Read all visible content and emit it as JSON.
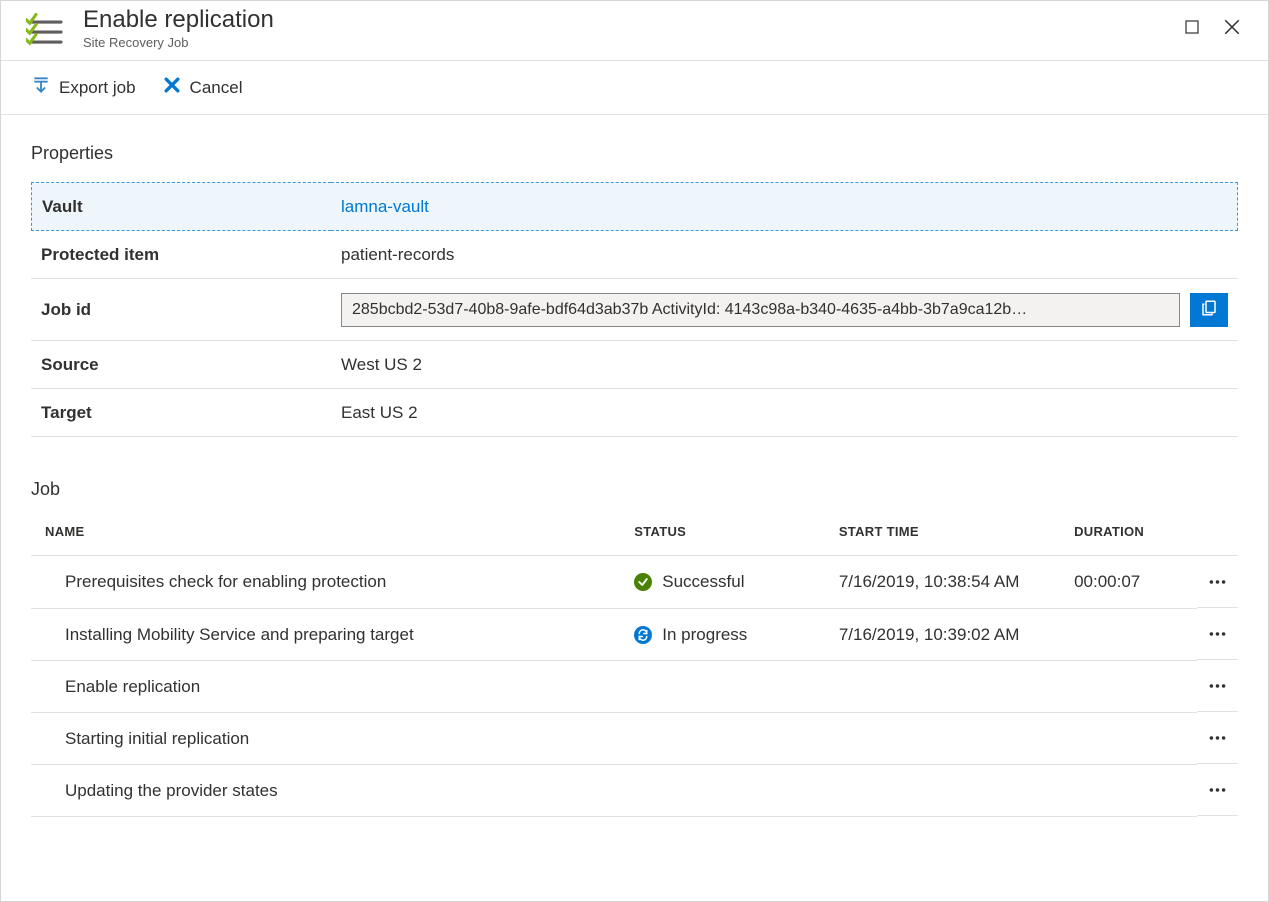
{
  "header": {
    "title": "Enable replication",
    "subtitle": "Site Recovery Job"
  },
  "toolbar": {
    "export_label": "Export job",
    "cancel_label": "Cancel"
  },
  "properties": {
    "section_title": "Properties",
    "rows": {
      "vault_label": "Vault",
      "vault_value": "lamna-vault",
      "protected_label": "Protected item",
      "protected_value": "patient-records",
      "jobid_label": "Job id",
      "jobid_value": "285bcbd2-53d7-40b8-9afe-bdf64d3ab37b ActivityId: 4143c98a-b340-4635-a4bb-3b7a9ca12b…",
      "source_label": "Source",
      "source_value": "West US 2",
      "target_label": "Target",
      "target_value": "East US 2"
    }
  },
  "job": {
    "section_title": "Job",
    "columns": {
      "name": "NAME",
      "status": "STATUS",
      "start": "START TIME",
      "duration": "DURATION"
    },
    "rows": [
      {
        "name": "Prerequisites check for enabling protection",
        "status": "Successful",
        "status_type": "success",
        "start": "7/16/2019, 10:38:54 AM",
        "duration": "00:00:07"
      },
      {
        "name": "Installing Mobility Service and preparing target",
        "status": "In progress",
        "status_type": "progress",
        "start": "7/16/2019, 10:39:02 AM",
        "duration": ""
      },
      {
        "name": "Enable replication",
        "status": "",
        "status_type": "",
        "start": "",
        "duration": ""
      },
      {
        "name": "Starting initial replication",
        "status": "",
        "status_type": "",
        "start": "",
        "duration": ""
      },
      {
        "name": "Updating the provider states",
        "status": "",
        "status_type": "",
        "start": "",
        "duration": ""
      }
    ]
  }
}
